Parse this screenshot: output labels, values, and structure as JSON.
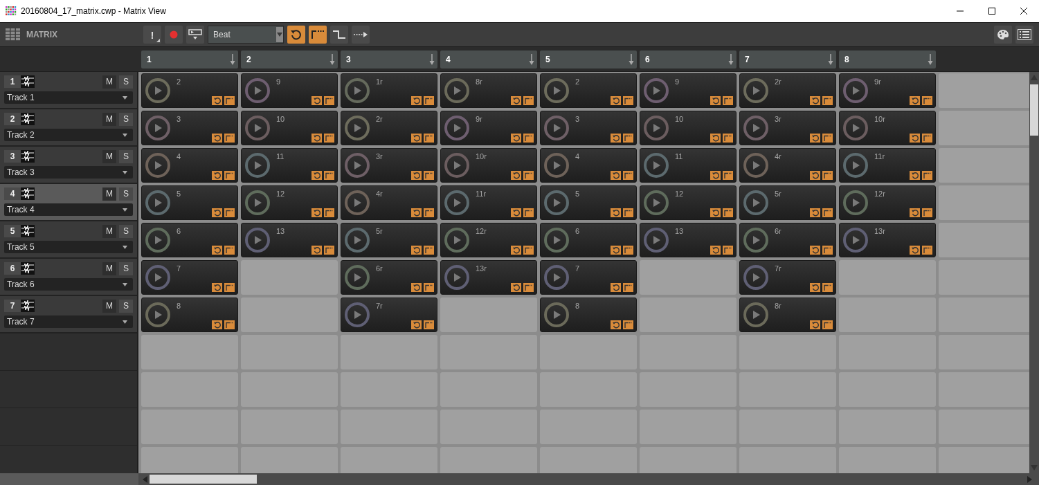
{
  "window": {
    "title": "20160804_17_matrix.cwp - Matrix View"
  },
  "toolbar": {
    "title": "MATRIX",
    "alert_button": "!",
    "quantize": "Beat",
    "toggles": [
      {
        "kind": "loop",
        "on": true
      },
      {
        "kind": "start",
        "on": true
      },
      {
        "kind": "step",
        "on": false
      },
      {
        "kind": "follow",
        "on": false
      }
    ]
  },
  "scenes": [
    {
      "label": "1"
    },
    {
      "label": "2"
    },
    {
      "label": "3"
    },
    {
      "label": "4"
    },
    {
      "label": "5"
    },
    {
      "label": "6"
    },
    {
      "label": "7"
    },
    {
      "label": "8"
    }
  ],
  "tracks": [
    {
      "number": "1",
      "name": "Track 1",
      "selected": false,
      "mute": "M",
      "solo": "S"
    },
    {
      "number": "2",
      "name": "Track 2",
      "selected": false,
      "mute": "M",
      "solo": "S"
    },
    {
      "number": "3",
      "name": "Track 3",
      "selected": false,
      "mute": "M",
      "solo": "S"
    },
    {
      "number": "4",
      "name": "Track 4",
      "selected": true,
      "mute": "M",
      "solo": "S"
    },
    {
      "number": "5",
      "name": "Track 5",
      "selected": false,
      "mute": "M",
      "solo": "S"
    },
    {
      "number": "6",
      "name": "Track 6",
      "selected": false,
      "mute": "M",
      "solo": "S"
    },
    {
      "number": "7",
      "name": "Track 7",
      "selected": false,
      "mute": "M",
      "solo": "S"
    }
  ],
  "grid_rows": [
    {
      "cells": [
        {
          "kind": "clip",
          "label": "2",
          "color": "#6d6c5c"
        },
        {
          "kind": "clip",
          "label": "9",
          "color": "#6e5e70"
        },
        {
          "kind": "clip",
          "label": "1r",
          "color": "#656a5c"
        },
        {
          "kind": "clip",
          "label": "8r",
          "color": "#6b6a5a"
        },
        {
          "kind": "clip",
          "label": "2",
          "color": "#6d6c5c"
        },
        {
          "kind": "clip",
          "label": "9",
          "color": "#6e5e70"
        },
        {
          "kind": "clip",
          "label": "2r",
          "color": "#6d6c5c"
        },
        {
          "kind": "clip",
          "label": "9r",
          "color": "#6e5e70"
        },
        {
          "kind": "empty"
        }
      ]
    },
    {
      "cells": [
        {
          "kind": "clip",
          "label": "3",
          "color": "#6e5f66"
        },
        {
          "kind": "clip",
          "label": "10",
          "color": "#6b5d5f"
        },
        {
          "kind": "clip",
          "label": "2r",
          "color": "#6d6c5c"
        },
        {
          "kind": "clip",
          "label": "9r",
          "color": "#6e5e70"
        },
        {
          "kind": "clip",
          "label": "3",
          "color": "#6e5f66"
        },
        {
          "kind": "clip",
          "label": "10",
          "color": "#6b5d5f"
        },
        {
          "kind": "clip",
          "label": "3r",
          "color": "#6e5f66"
        },
        {
          "kind": "clip",
          "label": "10r",
          "color": "#6b5d5f"
        },
        {
          "kind": "empty"
        }
      ]
    },
    {
      "cells": [
        {
          "kind": "clip",
          "label": "4",
          "color": "#6e6259"
        },
        {
          "kind": "clip",
          "label": "11",
          "color": "#5c6a6e"
        },
        {
          "kind": "clip",
          "label": "3r",
          "color": "#6e5f66"
        },
        {
          "kind": "clip",
          "label": "10r",
          "color": "#6b5d5f"
        },
        {
          "kind": "clip",
          "label": "4",
          "color": "#6e6259"
        },
        {
          "kind": "clip",
          "label": "11",
          "color": "#5c6a6e"
        },
        {
          "kind": "clip",
          "label": "4r",
          "color": "#6e6259"
        },
        {
          "kind": "clip",
          "label": "11r",
          "color": "#5c6a6e"
        },
        {
          "kind": "empty"
        }
      ]
    },
    {
      "cells": [
        {
          "kind": "clip",
          "label": "5",
          "color": "#5c6a6e"
        },
        {
          "kind": "clip",
          "label": "12",
          "color": "#5f6c5c"
        },
        {
          "kind": "clip",
          "label": "4r",
          "color": "#6e6259"
        },
        {
          "kind": "clip",
          "label": "11r",
          "color": "#5c6a6e"
        },
        {
          "kind": "clip",
          "label": "5",
          "color": "#5c6a6e"
        },
        {
          "kind": "clip",
          "label": "12",
          "color": "#5f6c5c"
        },
        {
          "kind": "clip",
          "label": "5r",
          "color": "#5c6a6e"
        },
        {
          "kind": "clip",
          "label": "12r",
          "color": "#5f6c5c"
        },
        {
          "kind": "empty"
        }
      ]
    },
    {
      "cells": [
        {
          "kind": "clip",
          "label": "6",
          "color": "#5f6c5c"
        },
        {
          "kind": "clip",
          "label": "13",
          "color": "#5f5f74"
        },
        {
          "kind": "clip",
          "label": "5r",
          "color": "#5c6a6e"
        },
        {
          "kind": "clip",
          "label": "12r",
          "color": "#5f6c5c"
        },
        {
          "kind": "clip",
          "label": "6",
          "color": "#5f6c5c"
        },
        {
          "kind": "clip",
          "label": "13",
          "color": "#5f5f74"
        },
        {
          "kind": "clip",
          "label": "6r",
          "color": "#5f6c5c"
        },
        {
          "kind": "clip",
          "label": "13r",
          "color": "#5f5f74"
        },
        {
          "kind": "empty"
        }
      ]
    },
    {
      "cells": [
        {
          "kind": "clip",
          "label": "7",
          "color": "#5f5f74"
        },
        {
          "kind": "empty"
        },
        {
          "kind": "clip",
          "label": "6r",
          "color": "#5f6c5c"
        },
        {
          "kind": "clip",
          "label": "13r",
          "color": "#5f5f74"
        },
        {
          "kind": "clip",
          "label": "7",
          "color": "#5f5f74"
        },
        {
          "kind": "empty"
        },
        {
          "kind": "clip",
          "label": "7r",
          "color": "#5f5f74"
        },
        {
          "kind": "empty"
        },
        {
          "kind": "empty"
        }
      ]
    },
    {
      "cells": [
        {
          "kind": "clip",
          "label": "8",
          "color": "#6b6a5a"
        },
        {
          "kind": "empty"
        },
        {
          "kind": "clip",
          "label": "7r",
          "color": "#5f5f74"
        },
        {
          "kind": "empty"
        },
        {
          "kind": "clip",
          "label": "8",
          "color": "#6b6a5a"
        },
        {
          "kind": "empty"
        },
        {
          "kind": "clip",
          "label": "8r",
          "color": "#6b6a5a"
        },
        {
          "kind": "empty"
        },
        {
          "kind": "empty"
        }
      ]
    },
    {
      "cells": [
        {
          "kind": "empty"
        },
        {
          "kind": "empty"
        },
        {
          "kind": "empty"
        },
        {
          "kind": "empty"
        },
        {
          "kind": "empty"
        },
        {
          "kind": "empty"
        },
        {
          "kind": "empty"
        },
        {
          "kind": "empty"
        },
        {
          "kind": "empty"
        }
      ]
    },
    {
      "cells": [
        {
          "kind": "empty"
        },
        {
          "kind": "empty"
        },
        {
          "kind": "empty"
        },
        {
          "kind": "empty"
        },
        {
          "kind": "empty"
        },
        {
          "kind": "empty"
        },
        {
          "kind": "empty"
        },
        {
          "kind": "empty"
        },
        {
          "kind": "empty"
        }
      ]
    },
    {
      "cells": [
        {
          "kind": "empty"
        },
        {
          "kind": "empty"
        },
        {
          "kind": "empty"
        },
        {
          "kind": "empty"
        },
        {
          "kind": "empty"
        },
        {
          "kind": "empty"
        },
        {
          "kind": "empty"
        },
        {
          "kind": "empty"
        },
        {
          "kind": "empty"
        }
      ]
    },
    {
      "cells": [
        {
          "kind": "empty"
        },
        {
          "kind": "empty"
        },
        {
          "kind": "empty"
        },
        {
          "kind": "empty"
        },
        {
          "kind": "empty"
        },
        {
          "kind": "empty"
        },
        {
          "kind": "empty"
        },
        {
          "kind": "empty"
        },
        {
          "kind": "empty"
        }
      ]
    }
  ]
}
